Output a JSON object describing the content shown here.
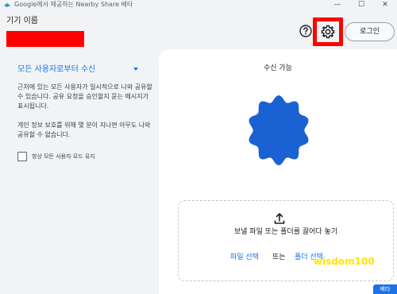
{
  "window": {
    "title": "Google에서 제공하는 Nearby Share 베타",
    "min_glyph": "—",
    "max_glyph": "☐",
    "close_glyph": "✕"
  },
  "device": {
    "label": "기기 이름"
  },
  "header": {
    "help_icon": "help-icon",
    "settings_icon": "gear-icon",
    "login_label": "로그인"
  },
  "sidebar": {
    "receive_mode": "모든 사용자로부터 수신",
    "paragraph1": "근처에 있는 모든 사용자가 일시적으로 나와 공유할 수 있습니다. 공유 요청을 승인할지 묻는 메시지가 표시됩니다.",
    "paragraph2": "개인 정보 보호를 위해 몇 분이 지나면 아무도 나와 공유할 수 없습니다.",
    "checkbox_label": "항상 모든 사용자 모드 유지",
    "checkbox_checked": false
  },
  "main": {
    "status": "수신 가능",
    "badge_color": "#1a62d3",
    "drop_text": "보낼 파일 또는 폴더를 끌어다 놓기",
    "file_select": "파일 선택",
    "or": "또는",
    "folder_select": "폴더 선택",
    "watermark": "wisdom100",
    "beta": "베타"
  },
  "colors": {
    "accent": "#1a73e8",
    "highlight": "#ff0000"
  }
}
